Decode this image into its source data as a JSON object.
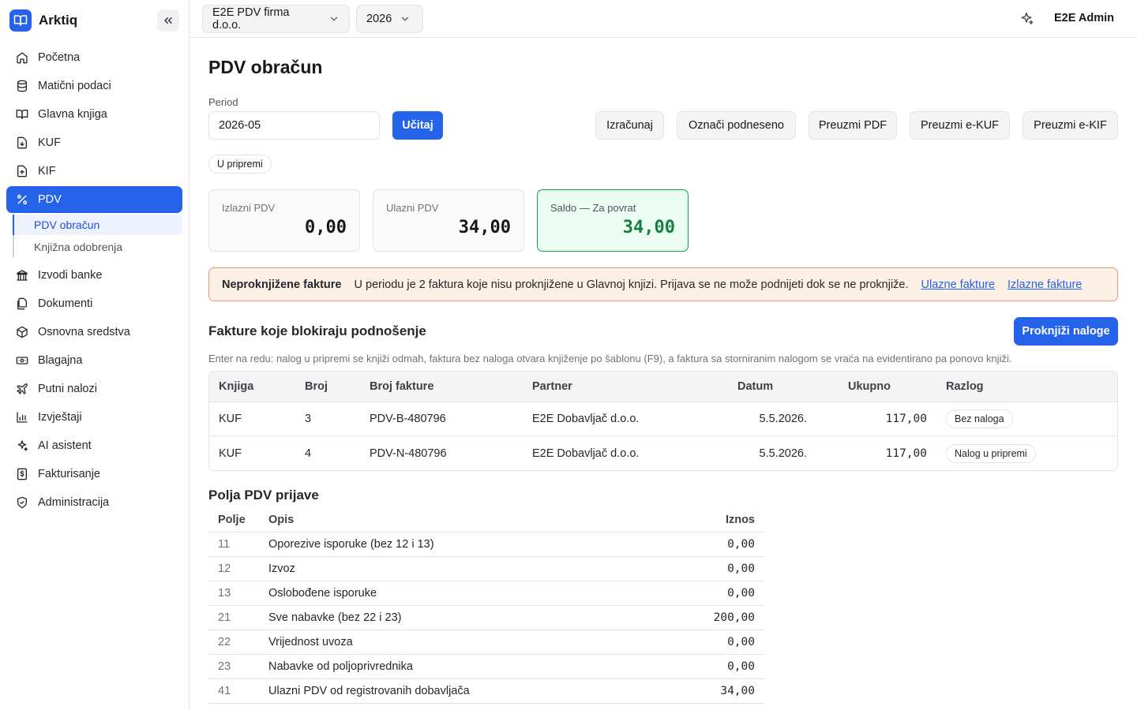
{
  "app": {
    "name": "Arktiq"
  },
  "sidebar": {
    "items": [
      {
        "label": "Početna",
        "icon": "home-icon"
      },
      {
        "label": "Matični podaci",
        "icon": "database-icon"
      },
      {
        "label": "Glavna knjiga",
        "icon": "book-open-icon"
      },
      {
        "label": "KUF",
        "icon": "file-in-icon"
      },
      {
        "label": "KIF",
        "icon": "file-out-icon"
      },
      {
        "label": "PDV",
        "icon": "percent-icon",
        "active": true
      },
      {
        "label": "Izvodi banke",
        "icon": "bank-icon"
      },
      {
        "label": "Dokumenti",
        "icon": "files-icon"
      },
      {
        "label": "Osnovna sredstva",
        "icon": "package-icon"
      },
      {
        "label": "Blagajna",
        "icon": "cash-icon"
      },
      {
        "label": "Putni nalozi",
        "icon": "plane-icon"
      },
      {
        "label": "Izvještaji",
        "icon": "chart-icon"
      },
      {
        "label": "AI asistent",
        "icon": "sparkles-icon"
      },
      {
        "label": "Fakturisanje",
        "icon": "invoice-dollar-icon"
      },
      {
        "label": "Administracija",
        "icon": "shield-icon"
      }
    ],
    "pdv_sub": [
      {
        "label": "PDV obračun",
        "active": true
      },
      {
        "label": "Knjižna odobrenja"
      }
    ]
  },
  "topbar": {
    "company": "E2E PDV firma d.o.o.",
    "year": "2026",
    "user": "E2E Admin"
  },
  "page": {
    "title": "PDV obračun",
    "period_label": "Period",
    "period_value": "2026-05",
    "load_button": "Učitaj",
    "actions": [
      "Izračunaj",
      "Označi podneseno",
      "Preuzmi PDF",
      "Preuzmi e-KUF",
      "Preuzmi e-KIF"
    ],
    "status": "U pripremi"
  },
  "summary": {
    "output_label": "Izlazni PDV",
    "output_value": "0,00",
    "input_label": "Ulazni PDV",
    "input_value": "34,00",
    "balance_label": "Saldo — Za povrat",
    "balance_value": "34,00"
  },
  "alert": {
    "title": "Neproknjižene fakture",
    "message": "U periodu je 2 faktura koje nisu proknjižene u Glavnoj knjizi. Prijava se ne može podnijeti dok se ne proknjiže.",
    "link_in": "Ulazne fakture",
    "link_out": "Izlazne fakture"
  },
  "blocking": {
    "title": "Fakture koje blokiraju podnošenje",
    "button": "Proknjiži naloge",
    "hint": "Enter na redu: nalog u pripremi se knjiži odmah, faktura bez naloga otvara knjiženje po šablonu (F9), a faktura sa storniranim nalogom se vraća na evidentirano pa ponovo knjiži.",
    "columns": {
      "book": "Knjiga",
      "number": "Broj",
      "invoice": "Broj fakture",
      "partner": "Partner",
      "date": "Datum",
      "total": "Ukupno",
      "reason": "Razlog"
    },
    "rows": [
      {
        "book": "KUF",
        "number": "3",
        "invoice": "PDV-B-480796",
        "partner": "E2E Dobavljač d.o.o.",
        "date": "5.5.2026.",
        "total": "117,00",
        "reason": "Bez naloga"
      },
      {
        "book": "KUF",
        "number": "4",
        "invoice": "PDV-N-480796",
        "partner": "E2E Dobavljač d.o.o.",
        "date": "5.5.2026.",
        "total": "117,00",
        "reason": "Nalog u pripremi"
      }
    ]
  },
  "fields": {
    "title": "Polja PDV prijave",
    "columns": {
      "field": "Polje",
      "desc": "Opis",
      "amount": "Iznos"
    },
    "rows": [
      {
        "field": "11",
        "desc": "Oporezive isporuke (bez 12 i 13)",
        "amount": "0,00"
      },
      {
        "field": "12",
        "desc": "Izvoz",
        "amount": "0,00"
      },
      {
        "field": "13",
        "desc": "Oslobođene isporuke",
        "amount": "0,00"
      },
      {
        "field": "21",
        "desc": "Sve nabavke (bez 22 i 23)",
        "amount": "200,00"
      },
      {
        "field": "22",
        "desc": "Vrijednost uvoza",
        "amount": "0,00"
      },
      {
        "field": "23",
        "desc": "Nabavke od poljoprivrednika",
        "amount": "0,00"
      },
      {
        "field": "41",
        "desc": "Ulazni PDV od registrovanih dobavljača",
        "amount": "34,00"
      }
    ]
  },
  "colors": {
    "accent": "#2563eb",
    "success": "#15803d",
    "warning_bg": "#fdf0e6",
    "warning_border": "#ea9a6a"
  }
}
